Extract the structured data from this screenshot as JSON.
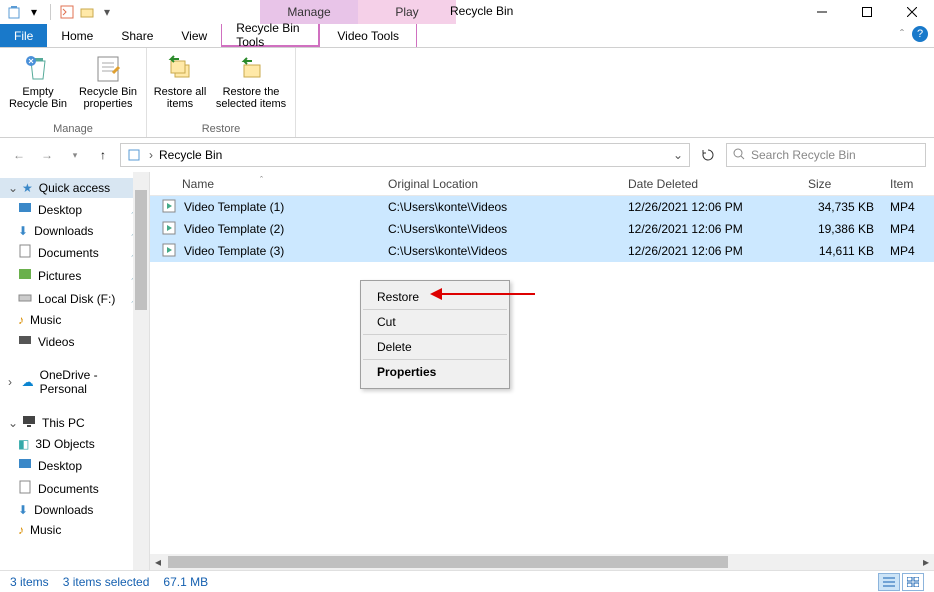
{
  "window": {
    "title": "Recycle Bin"
  },
  "contextTabs": {
    "manage_head": "Manage",
    "play_head": "Play",
    "manage_tab": "Recycle Bin Tools",
    "play_tab": "Video Tools"
  },
  "tabs": {
    "file": "File",
    "home": "Home",
    "share": "Share",
    "view": "View"
  },
  "ribbon": {
    "group_manage": "Manage",
    "group_restore": "Restore",
    "empty": "Empty Recycle Bin",
    "props": "Recycle Bin properties",
    "restore_all": "Restore all items",
    "restore_sel": "Restore the selected items"
  },
  "address": {
    "location": "Recycle Bin"
  },
  "search": {
    "placeholder": "Search Recycle Bin"
  },
  "nav": {
    "quick": "Quick access",
    "desktop": "Desktop",
    "downloads": "Downloads",
    "documents": "Documents",
    "pictures": "Pictures",
    "localdisk": "Local Disk (F:)",
    "music": "Music",
    "videos": "Videos",
    "onedrive": "OneDrive - Personal",
    "thispc": "This PC",
    "pc_3d": "3D Objects",
    "pc_desktop": "Desktop",
    "pc_documents": "Documents",
    "pc_downloads": "Downloads",
    "pc_music": "Music"
  },
  "columns": {
    "name": "Name",
    "orig": "Original Location",
    "date": "Date Deleted",
    "size": "Size",
    "type": "Item"
  },
  "rows": [
    {
      "name": "Video Template (1)",
      "orig": "C:\\Users\\konte\\Videos",
      "date": "12/26/2021 12:06 PM",
      "size": "34,735 KB",
      "type": "MP4"
    },
    {
      "name": "Video Template (2)",
      "orig": "C:\\Users\\konte\\Videos",
      "date": "12/26/2021 12:06 PM",
      "size": "19,386 KB",
      "type": "MP4"
    },
    {
      "name": "Video Template (3)",
      "orig": "C:\\Users\\konte\\Videos",
      "date": "12/26/2021 12:06 PM",
      "size": "14,611 KB",
      "type": "MP4"
    }
  ],
  "ctx": {
    "restore": "Restore",
    "cut": "Cut",
    "delete": "Delete",
    "properties": "Properties"
  },
  "status": {
    "count": "3 items",
    "selected": "3 items selected",
    "size": "67.1 MB"
  }
}
